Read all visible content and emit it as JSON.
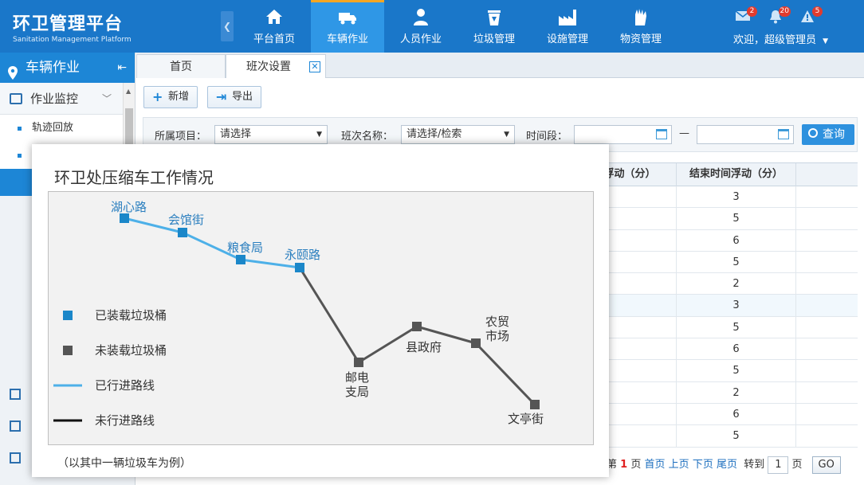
{
  "app": {
    "title_cn": "环卫管理平台",
    "title_en": "Sanitation Management Platform"
  },
  "nav": [
    {
      "label": "平台首页",
      "icon": "home-icon",
      "active": false
    },
    {
      "label": "车辆作业",
      "icon": "truck-icon",
      "active": true
    },
    {
      "label": "人员作业",
      "icon": "worker-icon",
      "active": false
    },
    {
      "label": "垃圾管理",
      "icon": "trash-bin-icon",
      "active": false
    },
    {
      "label": "设施管理",
      "icon": "factory-icon",
      "active": false
    },
    {
      "label": "物资管理",
      "icon": "glove-icon",
      "active": false
    }
  ],
  "notifications": {
    "mail": "2",
    "bell": "20",
    "alert": "5"
  },
  "user": {
    "welcome": "欢迎，超级管理员"
  },
  "sidebar": {
    "header": "车辆作业",
    "group": "作业监控",
    "items": [
      "轨迹回放"
    ]
  },
  "tabs": [
    {
      "label": "首页"
    },
    {
      "label": "班次设置"
    }
  ],
  "toolbar": {
    "add": "新增",
    "export": "导出"
  },
  "filter": {
    "project_label": "所属项目：",
    "project_value": "请选择",
    "shift_label": "班次名称：",
    "shift_value": "请选择/检索",
    "period_label": "时间段：",
    "dash": "—",
    "query": "查询"
  },
  "table": {
    "headers": [
      "间浮动（分）",
      "结束时间浮动（分）"
    ],
    "end_float_values": [
      "3",
      "5",
      "6",
      "5",
      "2",
      "3",
      "5",
      "6",
      "5",
      "2",
      "6",
      "5"
    ]
  },
  "pager": {
    "prefix": "第",
    "current": "1",
    "page_unit": "页",
    "first": "首页",
    "prev": "上页",
    "next": "下页",
    "last": "尾页",
    "goto_label": "转到",
    "goto_value": "1",
    "goto_unit": "页",
    "go": "GO"
  },
  "overlay": {
    "title": "环卫处压缩车工作情况",
    "note": "（以其中一辆垃圾车为例）",
    "legend": [
      {
        "label": "已装载垃圾桶",
        "type": "loaded-marker"
      },
      {
        "label": "未装载垃圾桶",
        "type": "unloaded-marker"
      },
      {
        "label": "已行进路线",
        "type": "traveled-line"
      },
      {
        "label": "未行进路线",
        "type": "untraveled-line"
      }
    ],
    "stops": [
      {
        "name": "湖心路",
        "loaded": true
      },
      {
        "name": "会馆街",
        "loaded": true
      },
      {
        "name": "粮食局",
        "loaded": true
      },
      {
        "name": "永颐路",
        "loaded": true
      },
      {
        "name": "邮电",
        "name2": "支局",
        "loaded": false
      },
      {
        "name": "县政府",
        "loaded": false
      },
      {
        "name": "农贸",
        "name2": "市场",
        "loaded": false
      },
      {
        "name": "文亭街",
        "loaded": false
      }
    ],
    "colors": {
      "loaded": "#1b87c9",
      "unloaded": "#555555",
      "traveled": "#4db0e8",
      "untraveled": "#555555",
      "label_loaded": "#2b7fbf",
      "label_unloaded": "#333333"
    }
  }
}
